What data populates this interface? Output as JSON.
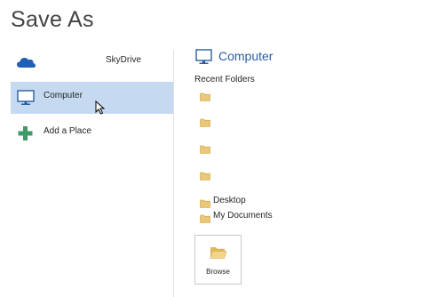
{
  "header": {
    "title": "Save As"
  },
  "places": [
    {
      "label": "SkyDrive",
      "icon": "cloud-icon"
    },
    {
      "label": "Computer",
      "icon": "computer-icon",
      "selected": true
    },
    {
      "label": "Add a Place",
      "icon": "plus-icon"
    }
  ],
  "main": {
    "section_title": "Computer",
    "section_icon": "computer-icon",
    "recent_title": "Recent Folders",
    "recent_folders": [
      {
        "label": ""
      },
      {
        "label": ""
      },
      {
        "label": ""
      },
      {
        "label": ""
      }
    ],
    "named_folders": [
      {
        "label": "Desktop"
      },
      {
        "label": "My Documents"
      }
    ],
    "browse_label": "Browse"
  },
  "colors": {
    "selected_bg": "#c5daf1",
    "accent": "#2a5d9f",
    "cloud": "#1f5fb8",
    "plus": "#3f9a6a",
    "folder": "#e9c879"
  }
}
